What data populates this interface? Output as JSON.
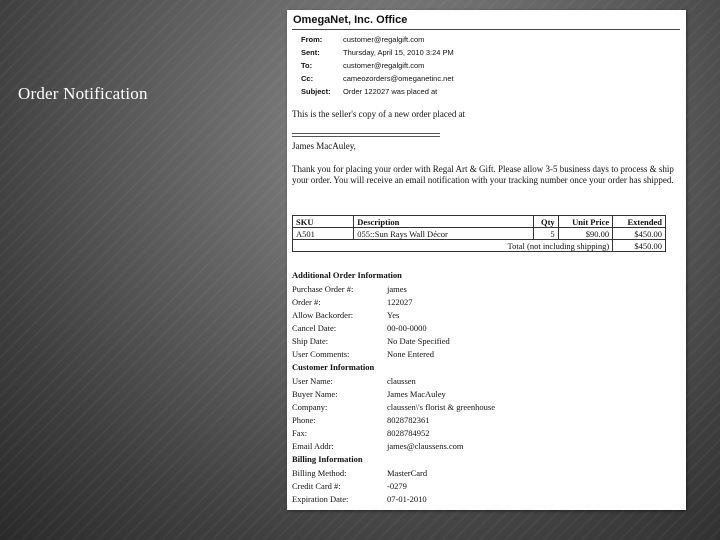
{
  "slide": {
    "title": "Order Notification"
  },
  "email": {
    "company": "OmegaNet, Inc. Office",
    "headers": [
      {
        "label": "From:",
        "value": "customer@regalgift.com"
      },
      {
        "label": "Sent:",
        "value": "Thursday, April 15, 2010 3:24 PM"
      },
      {
        "label": "To:",
        "value": "customer@regalgift.com"
      },
      {
        "label": "Cc:",
        "value": "cameozorders@omeganetinc.net"
      },
      {
        "label": "Subject:",
        "value": "Order 122027 was placed at"
      }
    ],
    "intro": "This is the seller's copy of a new order placed at",
    "salutation": "James MacAuley,",
    "message": "Thank you for placing your order with Regal Art & Gift. Please allow 3-5 business days to process & ship your order. You will receive an email notification with your tracking number once your order has shipped."
  },
  "order_table": {
    "headers": {
      "sku": "SKU",
      "description": "Description",
      "qty": "Qty",
      "unit_price": "Unit Price",
      "extended": "Extended"
    },
    "rows": [
      {
        "sku": "A501",
        "description": "055::Sun Rays Wall Décor",
        "qty": "5",
        "unit_price": "$90.00",
        "extended": "$450.00"
      }
    ],
    "total_label": "Total (not including shipping)",
    "total_value": "$450.00"
  },
  "additional": {
    "heading": "Additional Order Information",
    "rows": [
      {
        "label": "Purchase Order #:",
        "value": "james"
      },
      {
        "label": "Order #:",
        "value": "122027"
      },
      {
        "label": "Allow Backorder:",
        "value": "Yes"
      },
      {
        "label": "Cancel Date:",
        "value": "00-00-0000"
      },
      {
        "label": "Ship Date:",
        "value": "No Date Specified"
      },
      {
        "label": "User Comments:",
        "value": "None Entered"
      }
    ]
  },
  "customer": {
    "heading": "Customer Information",
    "rows": [
      {
        "label": "User Name:",
        "value": "claussen"
      },
      {
        "label": "Buyer Name:",
        "value": "James MacAuley"
      },
      {
        "label": "Company:",
        "value": "claussen\\'s florist & greenhouse"
      },
      {
        "label": "Phone:",
        "value": "8028782361"
      },
      {
        "label": "Fax:",
        "value": "8028784952"
      },
      {
        "label": "Email Addr:",
        "value": "james@claussens.com"
      }
    ]
  },
  "billing": {
    "heading": "Billing Information",
    "rows": [
      {
        "label": "Billing Method:",
        "value": "MasterCard"
      },
      {
        "label": "Credit Card #:",
        "value": "-0279"
      },
      {
        "label": "Expiration Date:",
        "value": "07-01-2010"
      }
    ]
  }
}
